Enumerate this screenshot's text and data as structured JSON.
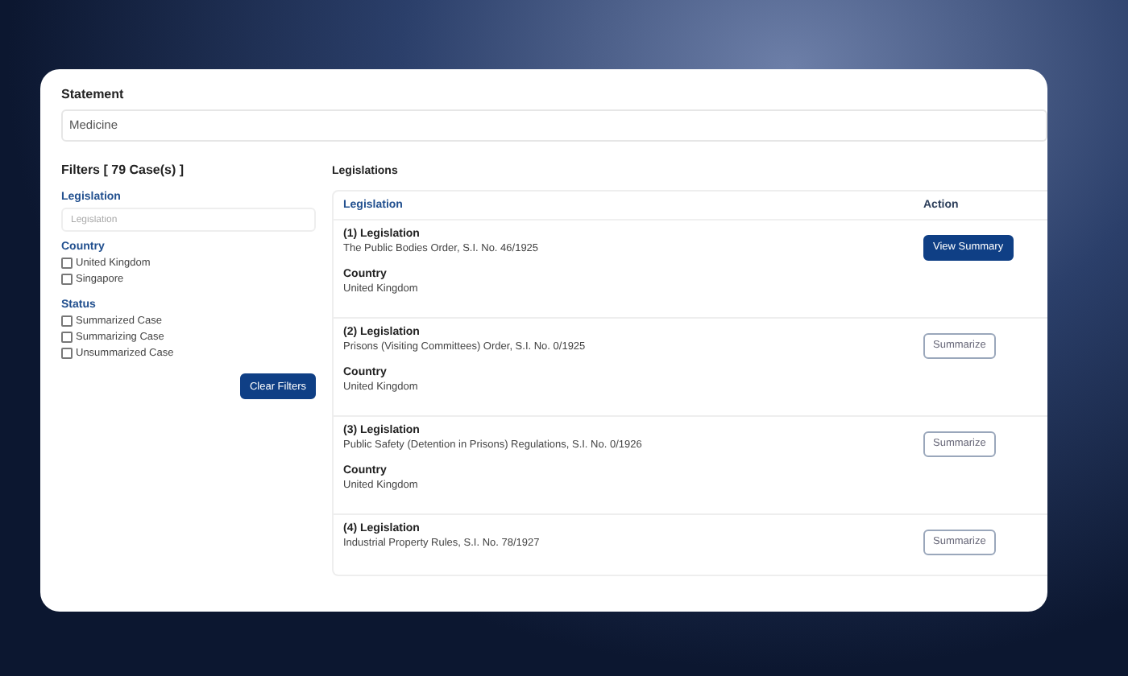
{
  "statement": {
    "label": "Statement",
    "value": "Medicine"
  },
  "filters": {
    "title": "Filters [ 79 Case(s) ]",
    "legislation": {
      "label": "Legislation",
      "placeholder": "Legislation"
    },
    "country": {
      "label": "Country",
      "options": [
        {
          "label": "United Kingdom",
          "checked": false
        },
        {
          "label": "Singapore",
          "checked": false
        }
      ]
    },
    "status": {
      "label": "Status",
      "options": [
        {
          "label": "Summarized Case",
          "checked": false
        },
        {
          "label": "Summarizing Case",
          "checked": false
        },
        {
          "label": "Unsummarized Case",
          "checked": false
        }
      ]
    },
    "clear_button": "Clear Filters"
  },
  "legislations": {
    "title": "Legislations",
    "columns": [
      "Legislation",
      "Action"
    ],
    "rows": [
      {
        "heading": "(1) Legislation",
        "name": "The Public Bodies Order, S.I. No. 46/1925",
        "country_label": "Country",
        "country": "United Kingdom",
        "action": {
          "label": "View Summary",
          "kind": "primary"
        }
      },
      {
        "heading": "(2) Legislation",
        "name": "Prisons (Visiting Committees) Order, S.I. No. 0/1925",
        "country_label": "Country",
        "country": "United Kingdom",
        "action": {
          "label": "Summarize",
          "kind": "outline"
        }
      },
      {
        "heading": "(3) Legislation",
        "name": "Public Safety (Detention in Prisons) Regulations, S.I. No. 0/1926",
        "country_label": "Country",
        "country": "United Kingdom",
        "action": {
          "label": "Summarize",
          "kind": "outline"
        }
      },
      {
        "heading": "(4) Legislation",
        "name": "Industrial Property Rules, S.I. No. 78/1927",
        "action": {
          "label": "Summarize",
          "kind": "outline"
        }
      }
    ]
  }
}
